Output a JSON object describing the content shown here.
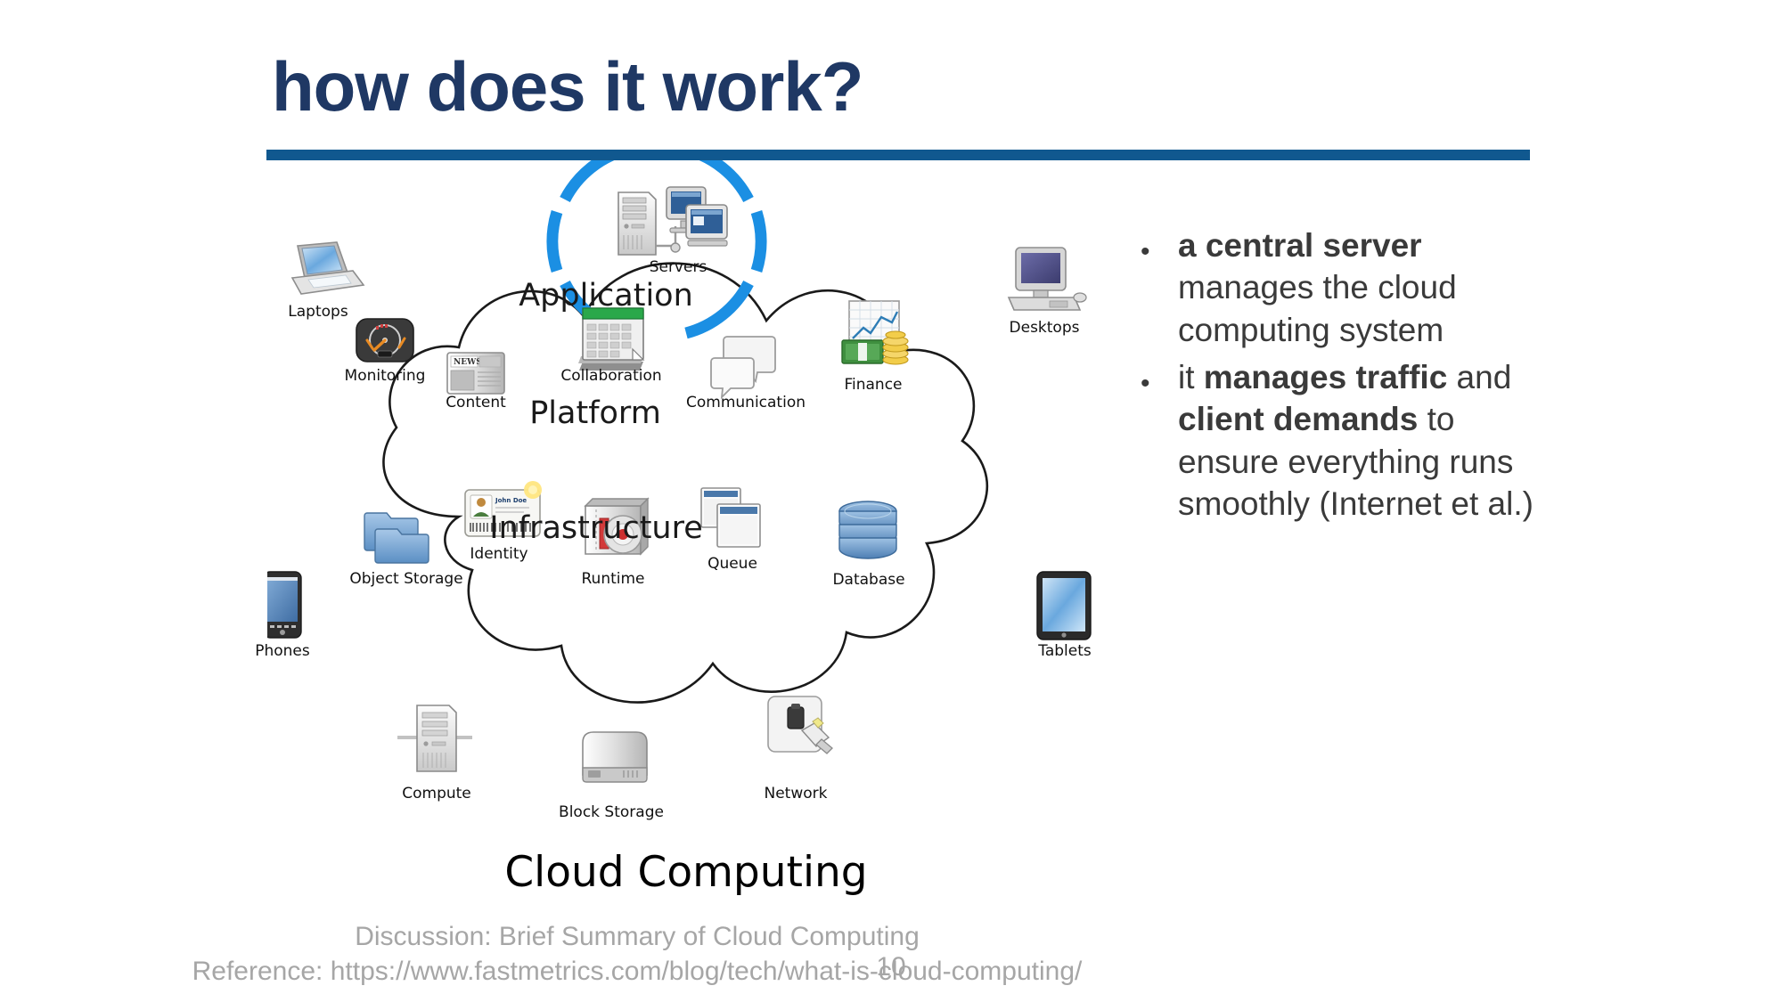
{
  "slide": {
    "title": "how does it work?",
    "title_color": "#1F3864",
    "rule_color": "#10588F",
    "page_number": "10"
  },
  "bullets": [
    {
      "marker": "•",
      "segments": [
        {
          "text": "a central server",
          "bold": true
        },
        {
          "text": " manages the cloud computing system",
          "bold": false
        }
      ],
      "plain": "a central server manages the cloud computing system"
    },
    {
      "marker": "•",
      "segments": [
        {
          "text": "it ",
          "bold": false
        },
        {
          "text": "manages traffic",
          "bold": true
        },
        {
          "text": " and ",
          "bold": false
        },
        {
          "text": "client demands",
          "bold": true
        },
        {
          "text": " to ensure everything runs smoothly (Internet et al.)",
          "bold": false
        }
      ],
      "plain": "it manages traffic and client demands to ensure everything runs smoothly (Internet et al.)"
    }
  ],
  "footer": {
    "line1": "Discussion: Brief Summary of Cloud Computing",
    "line2": "Reference: https://www.fastmetrics.com/blog/tech/what-is-cloud-computing/"
  },
  "diagram": {
    "cloud_title": "Cloud Computing",
    "servers_label": "Servers",
    "accent_color": "#1B8FE3",
    "layers": [
      {
        "name": "Application"
      },
      {
        "name": "Platform"
      },
      {
        "name": "Infrastructure"
      }
    ],
    "external_devices": [
      {
        "label": "Laptops",
        "icon": "laptop-icon"
      },
      {
        "label": "Desktops",
        "icon": "desktop-computer-icon"
      },
      {
        "label": "Phones",
        "icon": "smartphone-icon"
      },
      {
        "label": "Tablets",
        "icon": "tablet-icon"
      }
    ],
    "application_items": [
      {
        "label": "Monitoring",
        "icon": "gauge-icon"
      },
      {
        "label": "Content",
        "icon": "newspaper-icon"
      },
      {
        "label": "Collaboration",
        "icon": "calendar-icon"
      },
      {
        "label": "Communication",
        "icon": "speech-bubbles-icon"
      },
      {
        "label": "Finance",
        "icon": "money-chart-icon"
      }
    ],
    "platform_items": [
      {
        "label": "Object Storage",
        "icon": "folders-icon"
      },
      {
        "label": "Identity",
        "icon": "id-card-icon"
      },
      {
        "label": "Runtime",
        "icon": "disc-drive-icon"
      },
      {
        "label": "Queue",
        "icon": "stacked-windows-icon"
      },
      {
        "label": "Database",
        "icon": "database-cylinder-icon"
      }
    ],
    "infrastructure_items": [
      {
        "label": "Compute",
        "icon": "server-tower-icon"
      },
      {
        "label": "Block Storage",
        "icon": "hard-drive-icon"
      },
      {
        "label": "Network",
        "icon": "network-jack-icon"
      }
    ]
  }
}
